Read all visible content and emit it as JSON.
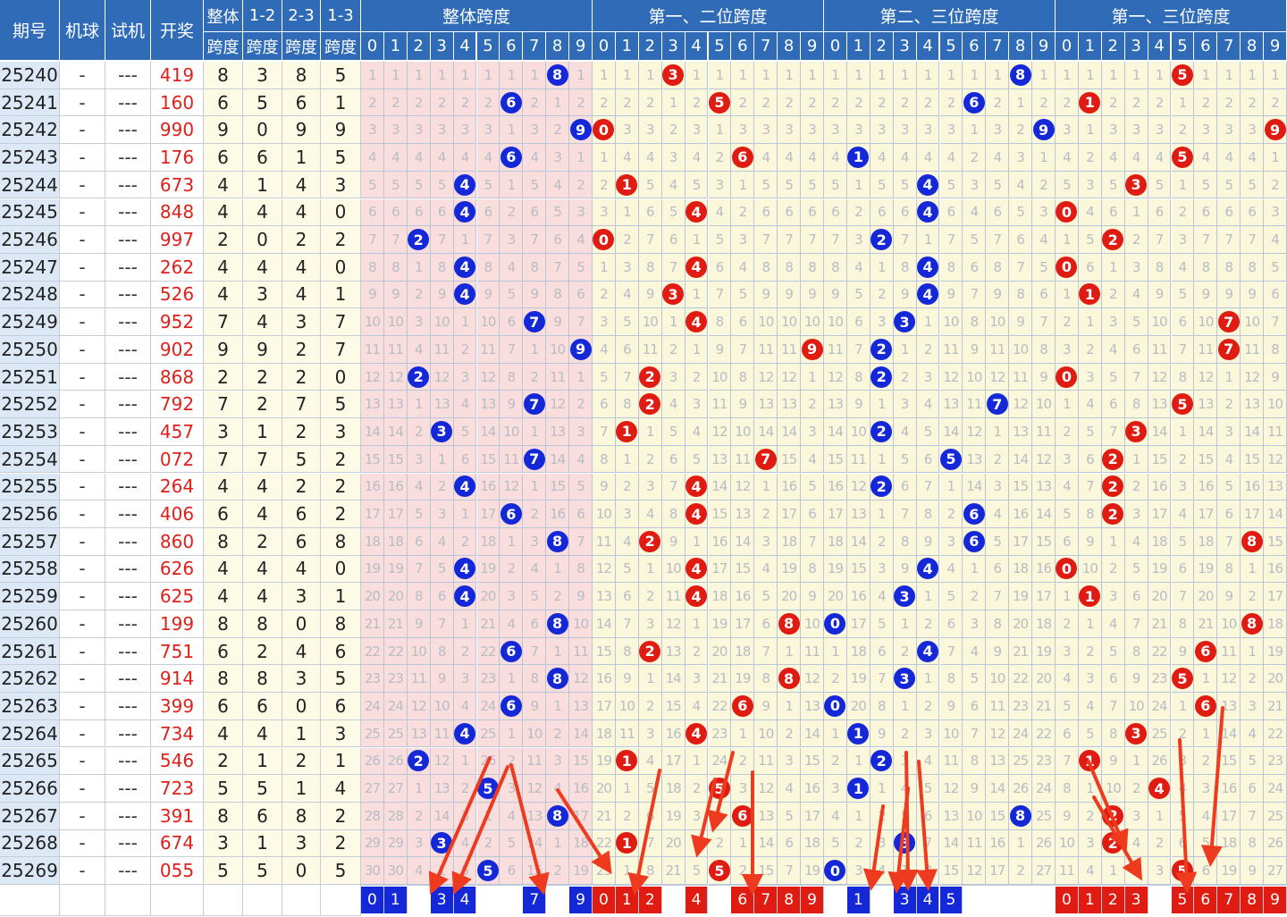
{
  "chart_data": {
    "type": "table",
    "header": {
      "issue": "期号",
      "machine": "机球",
      "test": "试机",
      "draw": "开奖",
      "span_total": [
        "整体",
        "跨度"
      ],
      "span_12": [
        "1-2",
        "跨度"
      ],
      "span_23": [
        "2-3",
        "跨度"
      ],
      "span_13": [
        "1-3",
        "跨度"
      ]
    },
    "groups": [
      {
        "title": "整体跨度",
        "color": "#1428d8"
      },
      {
        "title": "第一、二位跨度",
        "color": "#e01b12"
      },
      {
        "title": "第二、三位跨度",
        "color": "#1428d8"
      },
      {
        "title": "第一、三位跨度",
        "color": "#e01b12"
      }
    ],
    "digits": [
      "0",
      "1",
      "2",
      "3",
      "4",
      "5",
      "6",
      "7",
      "8",
      "9"
    ],
    "rows": [
      {
        "issue": "25240",
        "machine": "-",
        "test": "---",
        "draw": "419",
        "spans": [
          8,
          3,
          8,
          5
        ]
      },
      {
        "issue": "25241",
        "machine": "-",
        "test": "---",
        "draw": "160",
        "spans": [
          6,
          5,
          6,
          1
        ]
      },
      {
        "issue": "25242",
        "machine": "-",
        "test": "---",
        "draw": "990",
        "spans": [
          9,
          0,
          9,
          9
        ]
      },
      {
        "issue": "25243",
        "machine": "-",
        "test": "---",
        "draw": "176",
        "spans": [
          6,
          6,
          1,
          5
        ]
      },
      {
        "issue": "25244",
        "machine": "-",
        "test": "---",
        "draw": "673",
        "spans": [
          4,
          1,
          4,
          3
        ]
      },
      {
        "issue": "25245",
        "machine": "-",
        "test": "---",
        "draw": "848",
        "spans": [
          4,
          4,
          4,
          0
        ]
      },
      {
        "issue": "25246",
        "machine": "-",
        "test": "---",
        "draw": "997",
        "spans": [
          2,
          0,
          2,
          2
        ]
      },
      {
        "issue": "25247",
        "machine": "-",
        "test": "---",
        "draw": "262",
        "spans": [
          4,
          4,
          4,
          0
        ]
      },
      {
        "issue": "25248",
        "machine": "-",
        "test": "---",
        "draw": "526",
        "spans": [
          4,
          3,
          4,
          1
        ]
      },
      {
        "issue": "25249",
        "machine": "-",
        "test": "---",
        "draw": "952",
        "spans": [
          7,
          4,
          3,
          7
        ]
      },
      {
        "issue": "25250",
        "machine": "-",
        "test": "---",
        "draw": "902",
        "spans": [
          9,
          9,
          2,
          7
        ]
      },
      {
        "issue": "25251",
        "machine": "-",
        "test": "---",
        "draw": "868",
        "spans": [
          2,
          2,
          2,
          0
        ]
      },
      {
        "issue": "25252",
        "machine": "-",
        "test": "---",
        "draw": "792",
        "spans": [
          7,
          2,
          7,
          5
        ]
      },
      {
        "issue": "25253",
        "machine": "-",
        "test": "---",
        "draw": "457",
        "spans": [
          3,
          1,
          2,
          3
        ]
      },
      {
        "issue": "25254",
        "machine": "-",
        "test": "---",
        "draw": "072",
        "spans": [
          7,
          7,
          5,
          2
        ]
      },
      {
        "issue": "25255",
        "machine": "-",
        "test": "---",
        "draw": "264",
        "spans": [
          4,
          4,
          2,
          2
        ]
      },
      {
        "issue": "25256",
        "machine": "-",
        "test": "---",
        "draw": "406",
        "spans": [
          6,
          4,
          6,
          2
        ]
      },
      {
        "issue": "25257",
        "machine": "-",
        "test": "---",
        "draw": "860",
        "spans": [
          8,
          2,
          6,
          8
        ]
      },
      {
        "issue": "25258",
        "machine": "-",
        "test": "---",
        "draw": "626",
        "spans": [
          4,
          4,
          4,
          0
        ]
      },
      {
        "issue": "25259",
        "machine": "-",
        "test": "---",
        "draw": "625",
        "spans": [
          4,
          4,
          3,
          1
        ]
      },
      {
        "issue": "25260",
        "machine": "-",
        "test": "---",
        "draw": "199",
        "spans": [
          8,
          8,
          0,
          8
        ]
      },
      {
        "issue": "25261",
        "machine": "-",
        "test": "---",
        "draw": "751",
        "spans": [
          6,
          2,
          4,
          6
        ]
      },
      {
        "issue": "25262",
        "machine": "-",
        "test": "---",
        "draw": "914",
        "spans": [
          8,
          8,
          3,
          5
        ]
      },
      {
        "issue": "25263",
        "machine": "-",
        "test": "---",
        "draw": "399",
        "spans": [
          6,
          6,
          0,
          6
        ]
      },
      {
        "issue": "25264",
        "machine": "-",
        "test": "---",
        "draw": "734",
        "spans": [
          4,
          4,
          1,
          3
        ]
      },
      {
        "issue": "25265",
        "machine": "-",
        "test": "---",
        "draw": "546",
        "spans": [
          2,
          1,
          2,
          1
        ]
      },
      {
        "issue": "25266",
        "machine": "-",
        "test": "---",
        "draw": "723",
        "spans": [
          5,
          5,
          1,
          4
        ]
      },
      {
        "issue": "25267",
        "machine": "-",
        "test": "---",
        "draw": "391",
        "spans": [
          8,
          6,
          8,
          2
        ]
      },
      {
        "issue": "25268",
        "machine": "-",
        "test": "---",
        "draw": "674",
        "spans": [
          3,
          1,
          3,
          2
        ]
      },
      {
        "issue": "25269",
        "machine": "-",
        "test": "---",
        "draw": "055",
        "spans": [
          5,
          5,
          0,
          5
        ]
      }
    ],
    "predictions": [
      [
        "0",
        "1",
        "3",
        "4",
        "7",
        "9"
      ],
      [
        "0",
        "1",
        "2",
        "4",
        "6",
        "7",
        "8",
        "9"
      ],
      [
        "1",
        "3",
        "4",
        "5"
      ],
      [
        "0",
        "1",
        "2",
        "3",
        "5",
        "6",
        "7",
        "8",
        "9"
      ]
    ],
    "colors": {
      "header_bg": "#2f6bb6",
      "issue_bg": "#dce8f5",
      "draw_text": "#e0201a",
      "overall_grid_bg": "#f9dedd",
      "other_grid_bg": "#fbf7da",
      "blue_ball": "#1428d8",
      "red_ball": "#e01b12",
      "arrow": "#ee3a1e"
    }
  }
}
